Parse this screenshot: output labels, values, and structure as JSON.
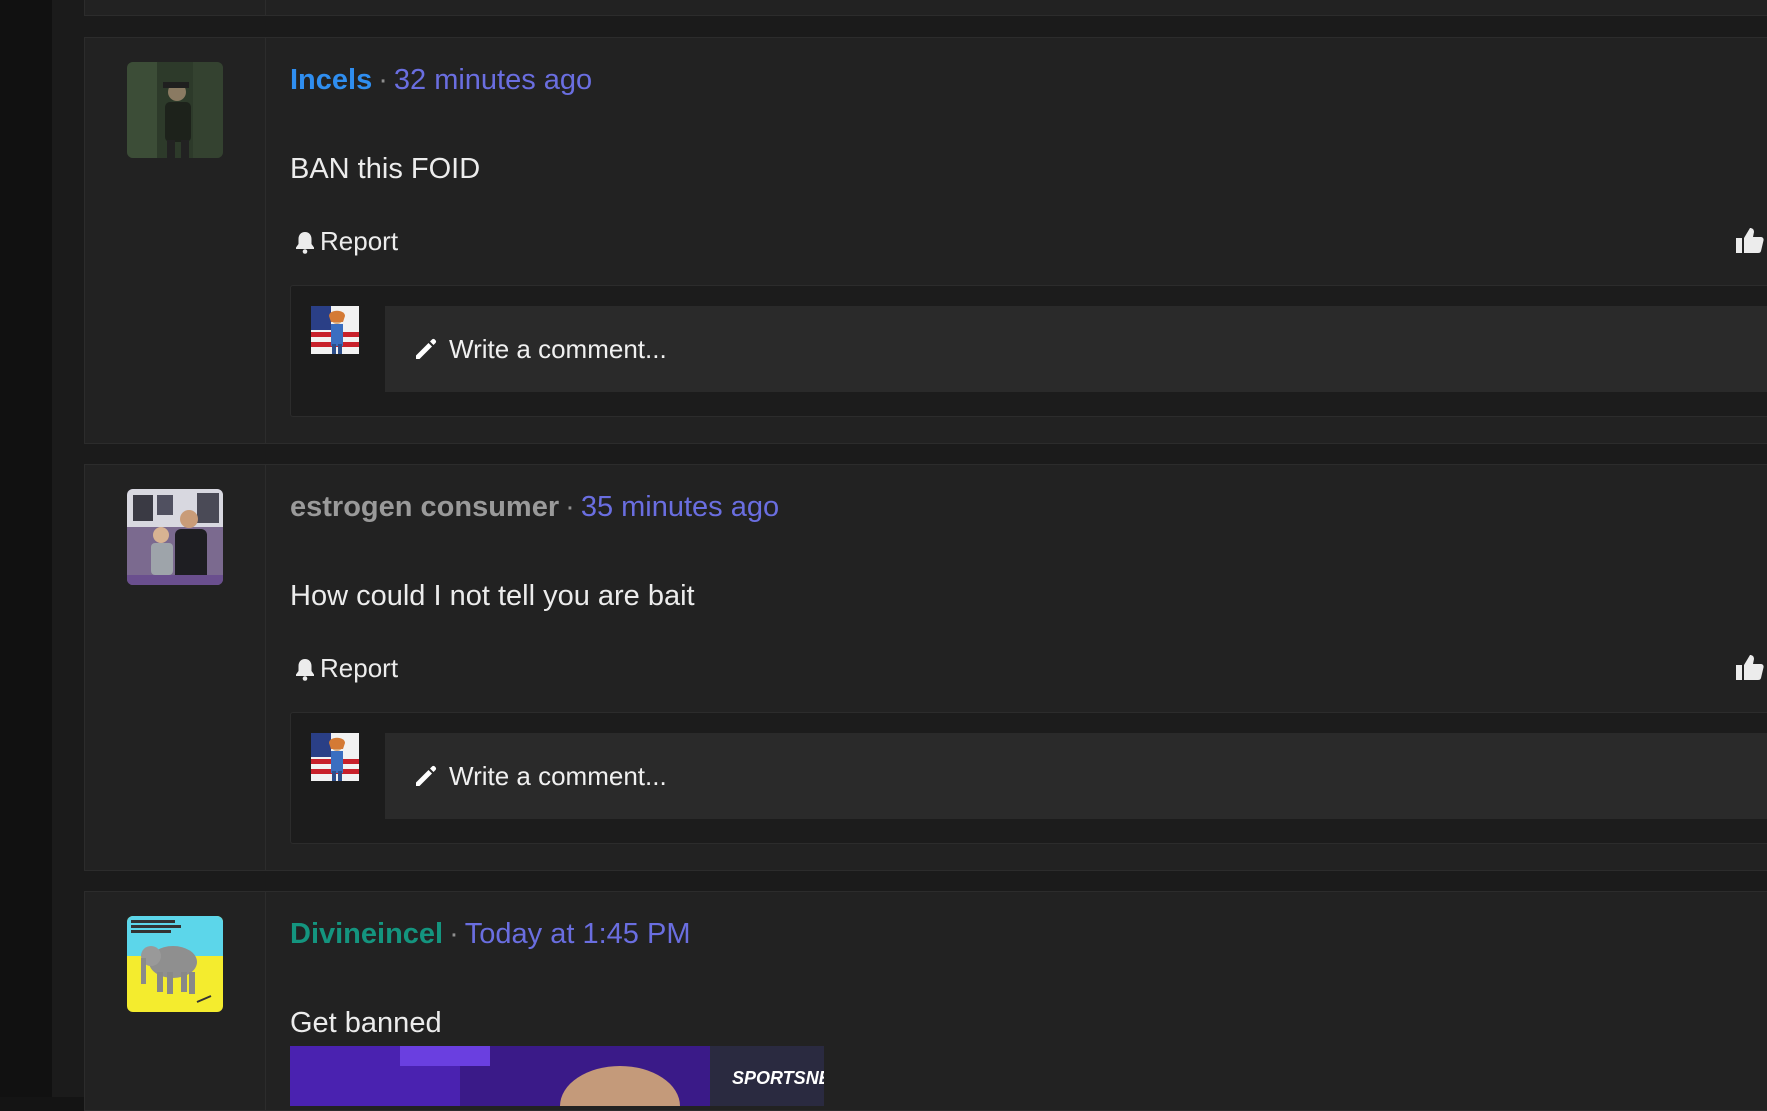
{
  "posts": [
    {
      "username": "Incels",
      "username_color": "#2f8ef0",
      "time": "32 minutes ago",
      "message": "BAN this FOID",
      "report_label": "Report",
      "comment_placeholder": "Write a comment..."
    },
    {
      "username": "estrogen consumer",
      "username_color": "#9a9a9a",
      "time": "35 minutes ago",
      "message": "How could I not tell you are bait",
      "report_label": "Report",
      "comment_placeholder": "Write a comment..."
    },
    {
      "username": "Divineincel",
      "username_color": "#14957f",
      "time": "Today at 1:45 PM",
      "message": "Get banned",
      "attachment_caption": "SPORTSNET"
    }
  ],
  "separator": "·",
  "icons": {
    "report": "bell-icon",
    "like": "thumbs-up-icon",
    "compose": "pencil-icon"
  },
  "colors": {
    "accent_time": "#6a6ee0",
    "background": "#222222"
  }
}
